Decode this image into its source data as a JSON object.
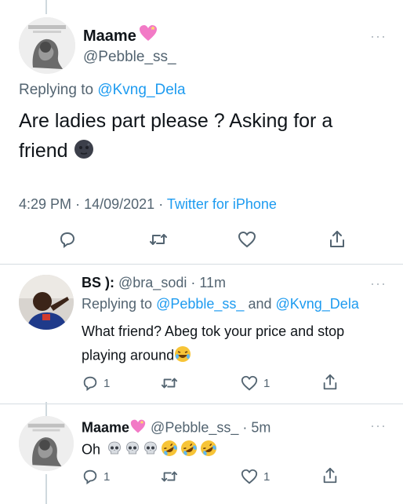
{
  "main_tweet": {
    "display_name": "Maame",
    "name_emoji": "heart-emoji",
    "handle": "@Pebble_ss_",
    "replying_prefix": "Replying to",
    "replying_to": "@Kvng_Dela",
    "text_line1": "Are ladies part please ? Asking for a",
    "text_line2": "friend",
    "text_emoji": "new-moon-face-emoji",
    "time": "4:29 PM",
    "date": "14/09/2021",
    "source": "Twitter for iPhone",
    "separator": "·"
  },
  "reply_1": {
    "display_name": "BS ):",
    "handle": "@bra_sodi",
    "age": "· 11m",
    "replying_prefix": "Replying to",
    "replying_to_1": "@Pebble_ss_",
    "and": "and",
    "replying_to_2": "@Kvng_Dela",
    "text_line1": "What friend? Abeg tok your price and stop",
    "text_line2": "playing around",
    "text_emoji": "laughing-emoji",
    "reply_count": "1",
    "like_count": "1"
  },
  "reply_2": {
    "display_name": "Maame",
    "name_emoji": "heart-emoji",
    "handle": "@Pebble_ss_",
    "age": "· 5m",
    "text": "Oh",
    "text_emojis": [
      "skull",
      "skull",
      "skull",
      "rofl",
      "rofl",
      "rofl"
    ],
    "reply_count": "1",
    "like_count": "1"
  },
  "colors": {
    "link_blue": "#1d9bf0",
    "secondary_grey": "#536471",
    "text": "#0f1419",
    "heart_pink": "#f27ac6"
  }
}
